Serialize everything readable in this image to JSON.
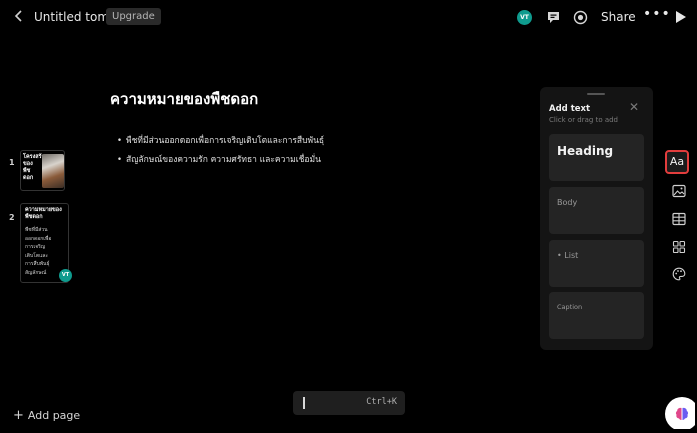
{
  "topbar": {
    "title": "Untitled tome",
    "upgrade_label": "Upgrade",
    "avatar_initials": "VT",
    "share_label": "Share",
    "more_label": "•••"
  },
  "thumbnails": [
    {
      "number": "1",
      "title": "โครงสร้างของพืชดอก"
    },
    {
      "number": "2",
      "title": "ความหมายของพืชดอก",
      "body": "พืชที่มีส่วนออกดอกเพื่อการเจริญเติบโตและการสืบพันธุ์ สัญลักษณ์",
      "avatar_initials": "VT"
    }
  ],
  "add_page_label": "Add page",
  "slide": {
    "title": "ความหมายของพืชดอก",
    "bullets": [
      "พืชที่มีส่วนออกดอกเพื่อการเจริญเติบโตและการสืบพันธุ์",
      "สัญลักษณ์ของความรัก ความศรัทธา และความเชื่อมั่น"
    ]
  },
  "command_bar": {
    "shortcut": "Ctrl+K"
  },
  "add_text_panel": {
    "title": "Add text",
    "subtitle": "Click or drag to add",
    "options": [
      "Heading",
      "Body",
      "• List",
      "Caption"
    ]
  },
  "toolbar": {
    "text_label": "Aa",
    "items": [
      "text-icon",
      "image-icon",
      "table-icon",
      "grid-icon",
      "palette-icon"
    ]
  },
  "colors": {
    "background": "#000000",
    "accent_avatar": "#0f9b8e",
    "highlight": "#e23d3d"
  }
}
